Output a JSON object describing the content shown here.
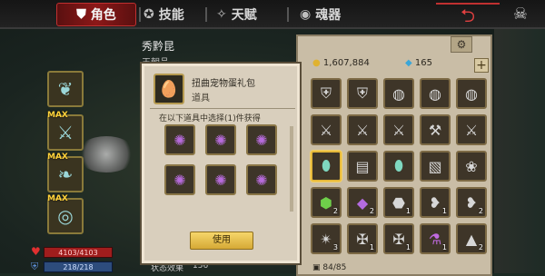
{
  "tabs": [
    {
      "label": "角色",
      "icon": "shield-crest-icon",
      "active": true
    },
    {
      "label": "技能",
      "icon": "swirl-icon"
    },
    {
      "label": "天赋",
      "icon": "wings-icon"
    },
    {
      "label": "魂器",
      "icon": "vortex-icon"
    }
  ],
  "character": {
    "name": "秀黔昆",
    "subtitle": "王朝品"
  },
  "stats": {
    "hp": "4103/4103",
    "mp": "218/218",
    "effect_label": "状态效果",
    "effect_value": "156"
  },
  "equipment": [
    {
      "icon": "beast-icon"
    },
    {
      "icon": "claw-icon",
      "max": "MAX"
    },
    {
      "icon": "wing-icon",
      "max": "MAX"
    },
    {
      "icon": "eye-icon",
      "max": "MAX"
    }
  ],
  "popup": {
    "title": "扭曲宠物蛋礼包",
    "type": "道具",
    "description": "在以下道具中选择(1)件获得",
    "options_count": 6,
    "use_label": "使用"
  },
  "currency": {
    "gold": "1,607,884",
    "gems": "165"
  },
  "inventory": {
    "rows": [
      [
        {
          "icon": "armor-icon"
        },
        {
          "icon": "armor-icon"
        },
        {
          "icon": "ring-icon"
        },
        {
          "icon": "ring-icon"
        },
        {
          "icon": "ring-icon"
        }
      ],
      [
        {
          "icon": "sword-icon"
        },
        {
          "icon": "sword-icon"
        },
        {
          "icon": "sword-icon"
        },
        {
          "icon": "axe-icon"
        },
        {
          "icon": "sword-icon"
        }
      ],
      [
        {
          "icon": "egg-icon",
          "selected": true
        },
        {
          "icon": "chest-icon"
        },
        {
          "icon": "egg-icon"
        },
        {
          "icon": "scroll-icon"
        },
        {
          "icon": "dog-icon"
        }
      ],
      [
        {
          "icon": "green-gem-icon",
          "count": "2"
        },
        {
          "icon": "purple-gem-icon",
          "count": "2"
        },
        {
          "icon": "stone-icon",
          "count": "1"
        },
        {
          "icon": "fang-icon",
          "count": "1"
        },
        {
          "icon": "fang-icon",
          "count": "2"
        }
      ],
      [
        {
          "icon": "claw-icon",
          "count": "3"
        },
        {
          "icon": "bone-icon",
          "count": "1"
        },
        {
          "icon": "bone-icon",
          "count": "1"
        },
        {
          "icon": "potion-icon",
          "count": "1"
        },
        {
          "icon": "shell-icon",
          "count": "2"
        }
      ]
    ],
    "capacity": "84/85"
  }
}
